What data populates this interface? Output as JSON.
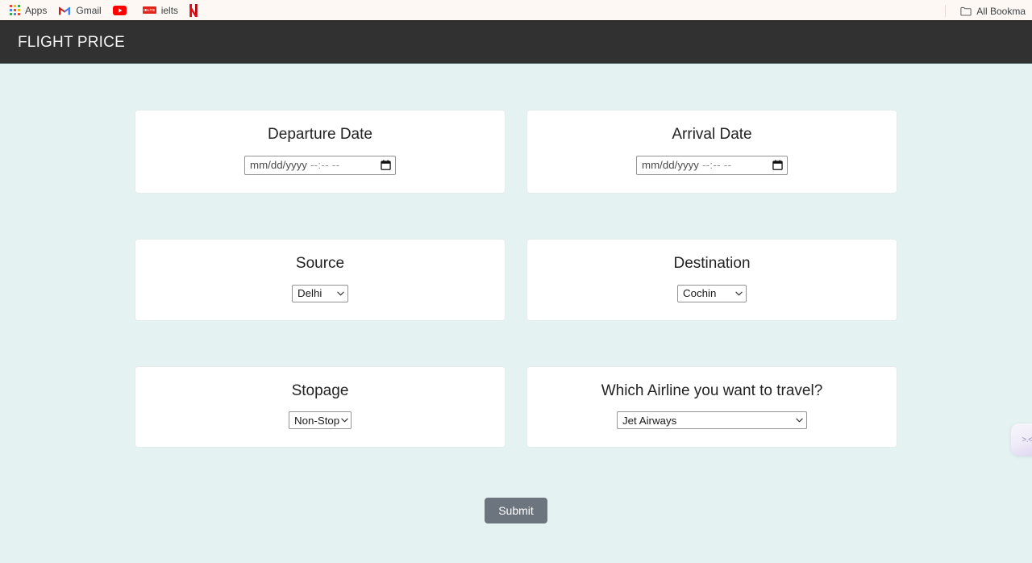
{
  "browser": {
    "bookmarks": [
      {
        "label": "Apps",
        "icon": "apps-grid-icon"
      },
      {
        "label": "Gmail",
        "icon": "gmail-icon"
      },
      {
        "label": "",
        "icon": "youtube-icon"
      },
      {
        "label": "ielts",
        "icon": "ielts-favicon",
        "favicon_text": "IELTS"
      },
      {
        "label": "",
        "icon": "netflix-icon"
      }
    ],
    "all_bookmarks_label": "All Bookma"
  },
  "navbar": {
    "title": "FLIGHT PRICE",
    "background": "#313131"
  },
  "theme": {
    "page_background": "#e4f2f1",
    "card_background": "#ffffff",
    "submit_color": "#6c757d"
  },
  "form": {
    "cards": [
      {
        "title": "Departure Date",
        "control": "datetime",
        "placeholder_date": "mm/dd/yyyy",
        "placeholder_time": "--:-- --"
      },
      {
        "title": "Arrival Date",
        "control": "datetime",
        "placeholder_date": "mm/dd/yyyy",
        "placeholder_time": "--:-- --"
      },
      {
        "title": "Source",
        "control": "select",
        "value": "Delhi"
      },
      {
        "title": "Destination",
        "control": "select",
        "value": "Cochin"
      },
      {
        "title": "Stopage",
        "control": "select",
        "value": "Non-Stop"
      },
      {
        "title": "Which Airline you want to travel?",
        "control": "select",
        "value": "Jet Airways"
      }
    ],
    "submit_label": "Submit"
  },
  "assistant": {
    "glyph": ">.<"
  }
}
